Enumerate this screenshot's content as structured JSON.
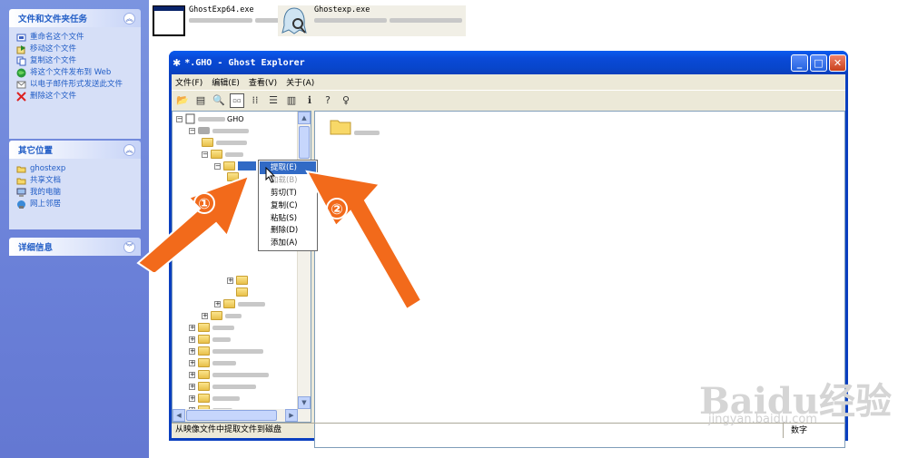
{
  "sidebar": {
    "file_tasks": {
      "title": "文件和文件夹任务",
      "items": [
        {
          "label": "重命名这个文件",
          "icon": "rename-icon"
        },
        {
          "label": "移动这个文件",
          "icon": "move-icon"
        },
        {
          "label": "复制这个文件",
          "icon": "copy-icon"
        },
        {
          "label": "将这个文件发布到 Web",
          "icon": "web-publish-icon"
        },
        {
          "label": "以电子邮件形式发送此文件",
          "icon": "email-icon"
        },
        {
          "label": "删除这个文件",
          "icon": "delete-icon"
        }
      ]
    },
    "other_places": {
      "title": "其它位置",
      "items": [
        {
          "label": "ghostexp",
          "icon": "folder-icon"
        },
        {
          "label": "共享文档",
          "icon": "shared-folder-icon"
        },
        {
          "label": "我的电脑",
          "icon": "computer-icon"
        },
        {
          "label": "网上邻居",
          "icon": "network-icon"
        }
      ]
    },
    "details": {
      "title": "详细信息"
    }
  },
  "top_files": [
    {
      "name": "GhostExp64.exe",
      "icon": "window-app-icon"
    },
    {
      "name": "Ghostexp.exe",
      "icon": "ghost-app-icon"
    }
  ],
  "window": {
    "title": "*.GHO - Ghost Explorer",
    "menu": [
      "文件(F)",
      "编辑(E)",
      "查看(V)",
      "关于(A)"
    ],
    "tree_root": "GHO",
    "status_left": "从映像文件中提取文件到磁盘",
    "status_right": "数字"
  },
  "context_menu": {
    "items": [
      {
        "label": "提取(E)",
        "state": "highlighted"
      },
      {
        "label": "加载(B)",
        "state": "disabled"
      },
      {
        "label": "剪切(T)",
        "state": "normal"
      },
      {
        "label": "复制(C)",
        "state": "normal"
      },
      {
        "label": "粘贴(S)",
        "state": "normal"
      },
      {
        "label": "删除(D)",
        "state": "normal"
      },
      {
        "label": "添加(A)",
        "state": "normal"
      }
    ]
  },
  "callouts": [
    "①",
    "②"
  ],
  "watermark": {
    "logo": "Baidu经验",
    "url": "jingyan.baidu.com"
  },
  "colors": {
    "xp_blue": "#0a3fc0",
    "arrow_orange": "#f26a1b",
    "menu_highlight": "#316ac5",
    "link_blue": "#215dc6"
  }
}
